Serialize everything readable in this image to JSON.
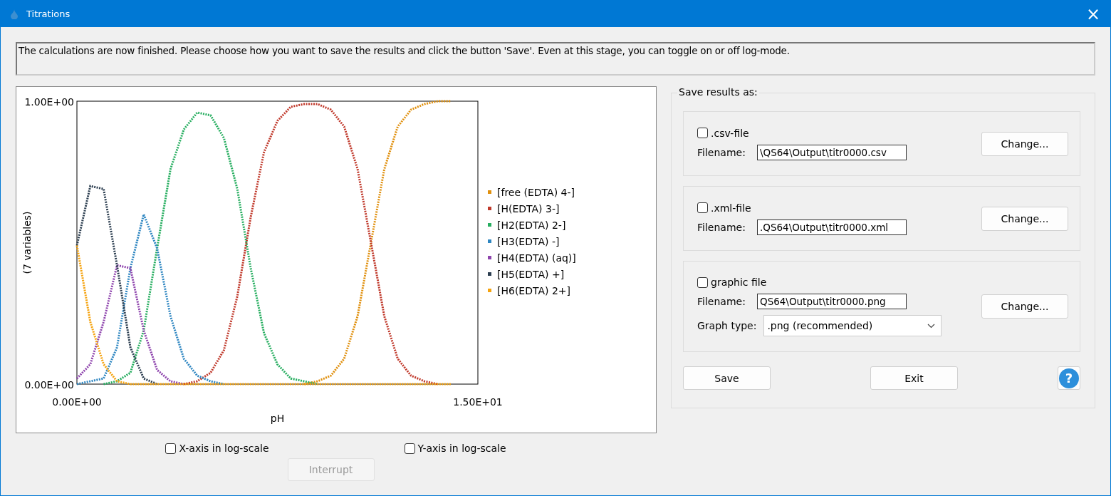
{
  "window": {
    "title": "Titrations",
    "close": "×"
  },
  "message": "The calculations are now finished. Please choose how you want to save the results and click the button 'Save'. Even at this stage, you can toggle on or off log-mode.",
  "chart": {
    "chart_data": {
      "type": "line",
      "xlabel": "pH",
      "ylabel": "(7 variables)",
      "xlim": [
        0,
        15
      ],
      "ylim": [
        0,
        1
      ],
      "xticks": [
        {
          "value": 0,
          "label": "0.00E+00"
        },
        {
          "value": 15,
          "label": "1.50E+01"
        }
      ],
      "yticks": [
        {
          "value": 0,
          "label": "0.00E+00"
        },
        {
          "value": 1,
          "label": "1.00E+00"
        }
      ],
      "legend": "right",
      "x": [
        0,
        0.5,
        1,
        1.5,
        2,
        2.5,
        3,
        3.5,
        4,
        4.5,
        5,
        5.5,
        6,
        6.5,
        7,
        7.5,
        8,
        8.5,
        9,
        9.5,
        10,
        10.5,
        11,
        11.5,
        12,
        12.5,
        13,
        13.5,
        14
      ],
      "series": [
        {
          "name": "[free (EDTA) 4-]",
          "color": "#e0900e",
          "line_style": "dotted",
          "values": [
            null,
            null,
            null,
            null,
            null,
            null,
            null,
            null,
            null,
            null,
            null,
            null,
            null,
            null,
            null,
            null,
            null,
            0,
            0.01,
            0.03,
            0.09,
            0.24,
            0.5,
            0.76,
            0.91,
            0.97,
            0.99,
            1,
            1
          ]
        },
        {
          "name": "[H(EDTA) 3-]",
          "color": "#c0392b",
          "line_style": "dotted",
          "values": [
            null,
            null,
            null,
            null,
            null,
            null,
            null,
            null,
            0,
            0.01,
            0.04,
            0.12,
            0.31,
            0.59,
            0.82,
            0.93,
            0.98,
            0.99,
            0.99,
            0.97,
            0.91,
            0.76,
            0.5,
            0.24,
            0.09,
            0.03,
            0.01,
            0,
            null
          ]
        },
        {
          "name": "[H2(EDTA) 2-]",
          "color": "#27ae60",
          "line_style": "dotted",
          "values": [
            null,
            null,
            0,
            0.01,
            0.04,
            0.19,
            0.48,
            0.76,
            0.9,
            0.96,
            0.95,
            0.87,
            0.69,
            0.41,
            0.18,
            0.07,
            0.02,
            0.01,
            0,
            null,
            null,
            null,
            null,
            null,
            null,
            null,
            null,
            null,
            null
          ]
        },
        {
          "name": "[H3(EDTA) -]",
          "color": "#2e86c1",
          "line_style": "dotted",
          "values": [
            0,
            0.01,
            0.02,
            0.13,
            0.41,
            0.6,
            0.48,
            0.24,
            0.09,
            0.03,
            0.01,
            0,
            null,
            null,
            null,
            null,
            null,
            null,
            null,
            null,
            null,
            null,
            null,
            null,
            null,
            null,
            null,
            null,
            null
          ]
        },
        {
          "name": "[H4(EDTA) (aq)]",
          "color": "#8e44ad",
          "line_style": "dotted",
          "values": [
            0.02,
            0.07,
            0.22,
            0.42,
            0.41,
            0.19,
            0.05,
            0.01,
            0,
            null,
            null,
            null,
            null,
            null,
            null,
            null,
            null,
            null,
            null,
            null,
            null,
            null,
            null,
            null,
            null,
            null,
            null,
            null,
            null
          ]
        },
        {
          "name": "[H5(EDTA) +]",
          "color": "#2c3e50",
          "line_style": "dotted",
          "values": [
            0.49,
            0.7,
            0.69,
            0.42,
            0.13,
            0.02,
            0,
            null,
            null,
            null,
            null,
            null,
            null,
            null,
            null,
            null,
            null,
            null,
            null,
            null,
            null,
            null,
            null,
            null,
            null,
            null,
            null,
            null,
            null
          ]
        },
        {
          "name": "[H6(EDTA) 2+]",
          "color": "#f5a30f",
          "line_style": "dotted",
          "values": [
            0.49,
            0.22,
            0.07,
            0.01,
            0,
            0,
            0,
            0,
            0,
            0,
            0,
            0,
            0,
            0,
            0,
            0,
            0,
            0,
            0,
            0,
            0,
            0,
            0,
            0,
            0,
            0,
            0,
            0,
            0
          ]
        }
      ]
    }
  },
  "log_options": [
    {
      "label": "X-axis in log-scale",
      "checked": false
    },
    {
      "label": "Y-axis in log-scale",
      "checked": false
    }
  ],
  "interrupt_button": {
    "label": "Interrupt",
    "disabled": true
  },
  "save_group": {
    "title": "Save results as:",
    "sections": [
      {
        "kind": "file",
        "label": ".csv-file",
        "checked": false,
        "filename_label": "Filename:",
        "filename": "\\QS64\\Output\\titr0000.csv",
        "button": "Change..."
      },
      {
        "kind": "file",
        "label": ".xml-file",
        "checked": false,
        "filename_label": "Filename:",
        "filename": ".QS64\\Output\\titr0000.xml",
        "button": "Change..."
      },
      {
        "kind": "graphic",
        "label": "graphic file",
        "checked": false,
        "filename_label": "Filename:",
        "filename": "QS64\\Output\\titr0000.png",
        "button": "Change...",
        "graph_type_label": "Graph type:",
        "graph_type": ".png (recommended)"
      }
    ]
  },
  "buttons": [
    {
      "kind": "text",
      "label": "Save"
    },
    {
      "kind": "text",
      "label": "Exit"
    },
    {
      "kind": "help",
      "label": "?"
    }
  ]
}
